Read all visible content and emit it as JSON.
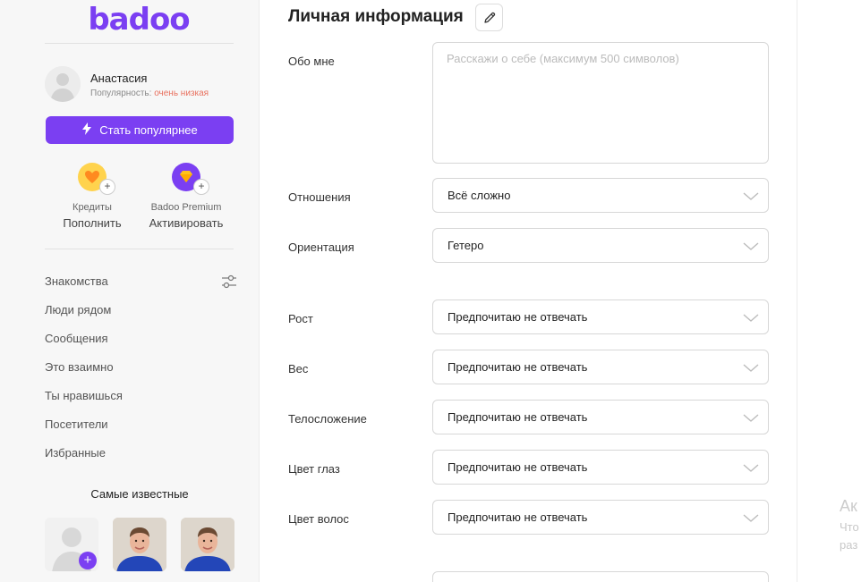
{
  "brand": {
    "logo": "badoo",
    "accent": "#7b3ff2"
  },
  "user": {
    "name": "Анастасия",
    "popularity_label": "Популярность: ",
    "popularity_level": "очень низкая",
    "popularity_color": "#e8715f"
  },
  "popular_button": {
    "label": "Стать популярнее",
    "icon": "lightning-icon"
  },
  "wallet": {
    "credits": {
      "label": "Кредиты",
      "action": "Пополнить",
      "icon": "heart-coin-icon",
      "color": "#ffd34d"
    },
    "premium": {
      "label": "Badoo Premium",
      "action": "Активировать",
      "icon": "diamond-icon",
      "color": "#7b3ff2"
    }
  },
  "nav": {
    "items": [
      {
        "label": "Знакомства",
        "has_filter": true
      },
      {
        "label": "Люди рядом"
      },
      {
        "label": "Сообщения"
      },
      {
        "label": "Это взаимно"
      },
      {
        "label": "Ты нравишься"
      },
      {
        "label": "Посетители"
      },
      {
        "label": "Избранные"
      }
    ],
    "filter_icon": "sliders-icon"
  },
  "famous": {
    "title": "Самые известные"
  },
  "profile": {
    "section_title": "Личная информация",
    "edit_icon": "pencil-icon",
    "about": {
      "label": "Обо мне",
      "placeholder": "Расскажи о себе (максимум 500 символов)",
      "value": ""
    },
    "fields": [
      {
        "label": "Отношения",
        "value": "Всё сложно"
      },
      {
        "label": "Ориентация",
        "value": "Гетеро"
      },
      {
        "label": "Рост",
        "value": "Предпочитаю не отвечать"
      },
      {
        "label": "Вес",
        "value": "Предпочитаю не отвечать"
      },
      {
        "label": "Телосложение",
        "value": "Предпочитаю не отвечать"
      },
      {
        "label": "Цвет глаз",
        "value": "Предпочитаю не отвечать"
      },
      {
        "label": "Цвет волос",
        "value": "Предпочитаю не отвечать"
      }
    ]
  },
  "right_panel": {
    "title": "Ак",
    "line1": "Что",
    "line2": "раз"
  }
}
